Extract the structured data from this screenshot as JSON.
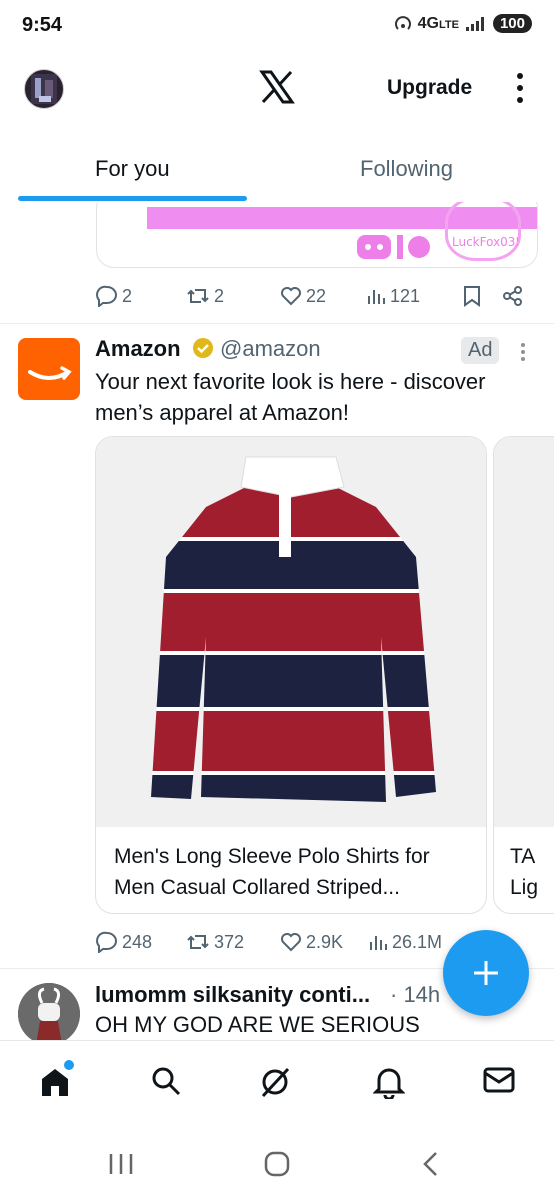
{
  "status_bar": {
    "time": "9:54",
    "network": "4G",
    "network_sub": "LTE",
    "battery": "100"
  },
  "header": {
    "upgrade_label": "Upgrade"
  },
  "tabs": [
    {
      "label": "For you"
    },
    {
      "label": "Following"
    }
  ],
  "prev_post": {
    "replies": "2",
    "reposts": "2",
    "likes": "22",
    "views": "121",
    "image_text": "LuckFox035"
  },
  "ad_post": {
    "name": "Amazon",
    "handle": "@amazon",
    "badge": "Ad",
    "text": "Your next favorite look is here - discover men’s apparel at Amazon!",
    "cards": [
      {
        "title": "Men's Long Sleeve Polo Shirts for Men Casual Collared Striped..."
      },
      {
        "title": "TA Lig"
      }
    ],
    "replies": "248",
    "reposts": "372",
    "likes": "2.9K",
    "views": "26.1M"
  },
  "next_post": {
    "name": "lumomm silksanity conti...",
    "time": "· 14h",
    "text": "OH MY GOD ARE WE SERIOUS"
  },
  "colors": {
    "accent": "#1d9bf0",
    "amazon": "#ff6200",
    "verified": "#e2b719"
  }
}
